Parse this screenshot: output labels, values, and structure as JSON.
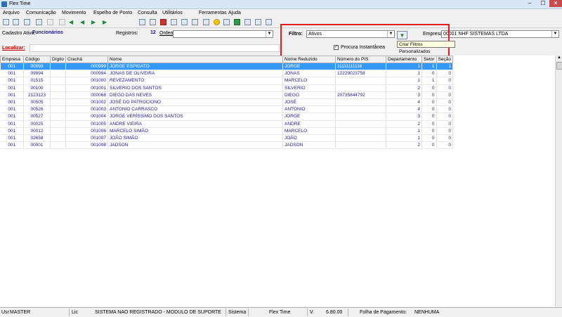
{
  "window": {
    "title": "Flex Time",
    "minimize": "–",
    "maximize": "☐",
    "close": "✕"
  },
  "menu": [
    "Arquivo",
    "Comunicação",
    "Movimento",
    "Espelho de Ponto",
    "Consulta",
    "Utilitários",
    "Ferramentas",
    "Ajuda"
  ],
  "form": {
    "cadastro_label": "Cadastro Ativo:",
    "cadastro_value": "Funcionários",
    "registros_label": "Registros:",
    "registros_value": "12",
    "ordem_label": "Ordem",
    "filtro_label": "Filtro:",
    "filtro_value": "Ativos",
    "empresa_label": "Empresa:",
    "empresa_value": "00001 NHF SISTEMAS LTDA",
    "procura_label": "Procura Instantânea",
    "procura_checked": true,
    "localizar_label": "Localizar:",
    "tooltip": "Criar Filtros Personalizados"
  },
  "table": {
    "columns": [
      "Empresa",
      "Código",
      "Dígito",
      "Crachá",
      "Nome",
      "Nome Reduzido",
      "Número do PIS",
      "Departamento",
      "Setor",
      "Seção"
    ],
    "rows": [
      [
        "001",
        "00999",
        "",
        "000999",
        "JORGE ESPIGATO",
        "JORGE",
        "11111111116",
        "1",
        "1",
        "1"
      ],
      [
        "001",
        "09994",
        "",
        "000994",
        "JONAS DE OLIVEIRA",
        "JONAS",
        "12229023758",
        "1",
        "0",
        "0"
      ],
      [
        "001",
        "01515",
        "",
        "001000",
        "REVEZAMENTO",
        "MARCELO",
        "",
        "1",
        "1",
        "0"
      ],
      [
        "001",
        "00100",
        "",
        "001001",
        "SILVERIO DOS SANTOS",
        "SILVERIO",
        "",
        "2",
        "0",
        "0"
      ],
      [
        "001",
        "2123123",
        "",
        "000068",
        "DIEGO DAS NEVES",
        "DIEGO",
        "20735844792",
        "3",
        "0",
        "0"
      ],
      [
        "001",
        "00505",
        "",
        "001002",
        "JOSÉ DO PATROCIONO",
        "JOSÉ",
        "",
        "4",
        "0",
        "0"
      ],
      [
        "001",
        "00526",
        "",
        "001003",
        "ANTONIO CARRASCO",
        "ANTONIO",
        "",
        "4",
        "0",
        "0"
      ],
      [
        "001",
        "00527",
        "",
        "001004",
        "JORGE VERÍSSIMO DOS SANTOS",
        "JORGE",
        "",
        "3",
        "0",
        "0"
      ],
      [
        "001",
        "00025",
        "",
        "001005",
        "ANDRE VIEIRA",
        "ANDRE",
        "",
        "2",
        "0",
        "0"
      ],
      [
        "001",
        "00012",
        "",
        "001006",
        "MARCELO SIMÃO",
        "MARCELO",
        "",
        "1",
        "0",
        "0"
      ],
      [
        "001",
        "02658",
        "",
        "001007",
        "JOÃO SIMÃO",
        "JOÃO",
        "",
        "1",
        "0",
        "0"
      ],
      [
        "001",
        "00001",
        "",
        "001008",
        "JADSON",
        "JADSON",
        "",
        "2",
        "0",
        "0"
      ]
    ],
    "selected_row": 0
  },
  "status": {
    "usr_label": "Usr",
    "usr_value": "MASTER",
    "lic_label": "Lic",
    "lic_value": "SISTEMA NAO REGISTRADO - MODULO DE SUPORTE",
    "sistema_label": "Sistema",
    "sistema_value": "Flex Time",
    "versao_label": "V.",
    "versao_value": "6.80.00",
    "folha_label": "Folha de Pagamento:",
    "folha_value": "NENHUMA"
  },
  "colors": {
    "accent": "#3399ff",
    "highlight": "#e21b23",
    "label_red": "#cc0000",
    "value_blue": "#1a1a8a"
  }
}
